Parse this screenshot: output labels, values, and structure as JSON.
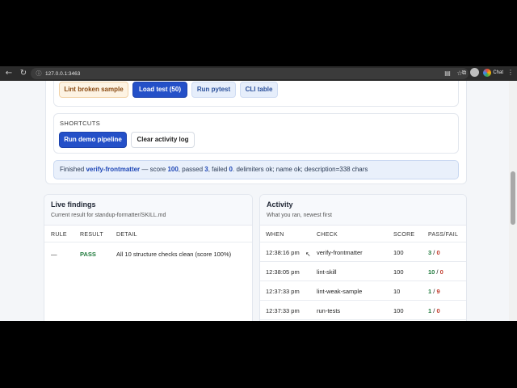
{
  "browser": {
    "url": "127.0.0.1:3463",
    "chat_label": "Chat"
  },
  "actions": {
    "lint_broken": "Lint broken sample",
    "load_test": "Load test (50)",
    "run_pytest": "Run pytest",
    "cli_table": "CLI table"
  },
  "shortcuts": {
    "label": "SHORTCUTS",
    "run_demo": "Run demo pipeline",
    "clear_log": "Clear activity log"
  },
  "status": {
    "prefix": "Finished",
    "check": "verify-frontmatter",
    "mid1": "— score",
    "score": "100",
    "mid2": ", passed",
    "passed": "3",
    "mid3": ", failed",
    "failed": "0",
    "suffix": ". delimiters ok; name ok; description=338 chars"
  },
  "findings": {
    "title": "Live findings",
    "subtitle": "Current result for standup-formatter/SKILL.md",
    "columns": [
      "RULE",
      "RESULT",
      "DETAIL"
    ],
    "rows": [
      {
        "rule": "—",
        "result": "PASS",
        "detail": "All 10 structure checks clean (score 100%)"
      }
    ]
  },
  "activity": {
    "title": "Activity",
    "subtitle": "What you ran, newest first",
    "columns": [
      "WHEN",
      "CHECK",
      "SCORE",
      "PASS/FAIL"
    ],
    "rows": [
      {
        "when": "12:38:16 pm",
        "check": "verify-frontmatter",
        "score": "100",
        "pass": "3",
        "sep": " / ",
        "fail": "0"
      },
      {
        "when": "12:38:05 pm",
        "check": "lint-skill",
        "score": "100",
        "pass": "10",
        "sep": " / ",
        "fail": "0"
      },
      {
        "when": "12:37:33 pm",
        "check": "lint-weak-sample",
        "score": "10",
        "pass": "1",
        "sep": " / ",
        "fail": "9"
      },
      {
        "when": "12:37:33 pm",
        "check": "run-tests",
        "score": "100",
        "pass": "1",
        "sep": " / ",
        "fail": "0"
      }
    ]
  },
  "colors": {
    "primary": "#2450c8",
    "pass_green": "#1f7a3c",
    "fail_red": "#c03a2b",
    "status_bg": "#e9f0fb"
  }
}
